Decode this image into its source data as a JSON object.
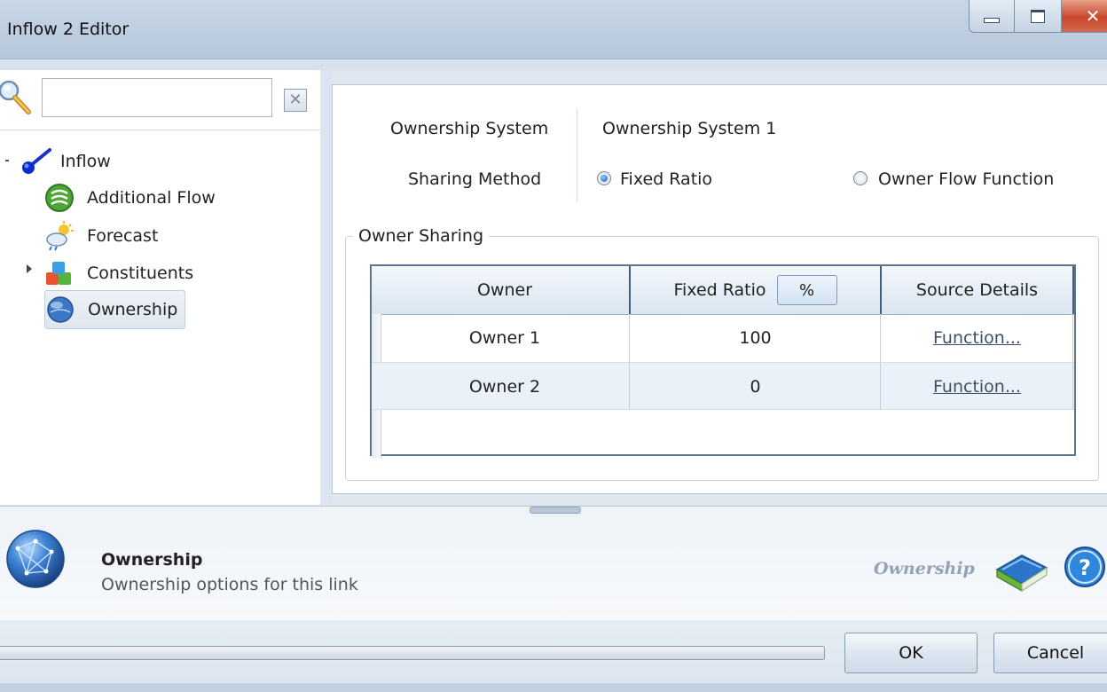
{
  "window": {
    "title": "Inflow 2 Editor"
  },
  "search": {
    "value": "",
    "placeholder": ""
  },
  "tree": {
    "root": "Inflow",
    "items": [
      {
        "label": "Additional Flow",
        "icon": "additional-flow-icon"
      },
      {
        "label": "Forecast",
        "icon": "forecast-icon"
      },
      {
        "label": "Constituents",
        "icon": "constituents-icon"
      },
      {
        "label": "Ownership",
        "icon": "ownership-globe-icon",
        "selected": true
      }
    ]
  },
  "ownership": {
    "system_label": "Ownership System",
    "system_value": "Ownership System 1",
    "sharing_label": "Sharing Method",
    "sharing_options": [
      {
        "label": "Fixed Ratio",
        "selected": true
      },
      {
        "label": "Owner Flow Function",
        "selected": false
      }
    ],
    "group_title": "Owner Sharing"
  },
  "grid": {
    "columns": [
      "Owner",
      "Fixed Ratio",
      "Source Details"
    ],
    "unit_button": "%",
    "rows": [
      {
        "owner": "Owner 1",
        "ratio": "100",
        "details": "Function..."
      },
      {
        "owner": "Owner 2",
        "ratio": "0",
        "details": "Function..."
      }
    ]
  },
  "info": {
    "title": "Ownership",
    "description": "Ownership options for this link",
    "tag": "Ownership"
  },
  "buttons": {
    "ok": "OK",
    "cancel": "Cancel"
  },
  "colors": {
    "title_bar": "#bccde0",
    "grid_border": "#5b7593",
    "selection": "#dfe6ef"
  }
}
